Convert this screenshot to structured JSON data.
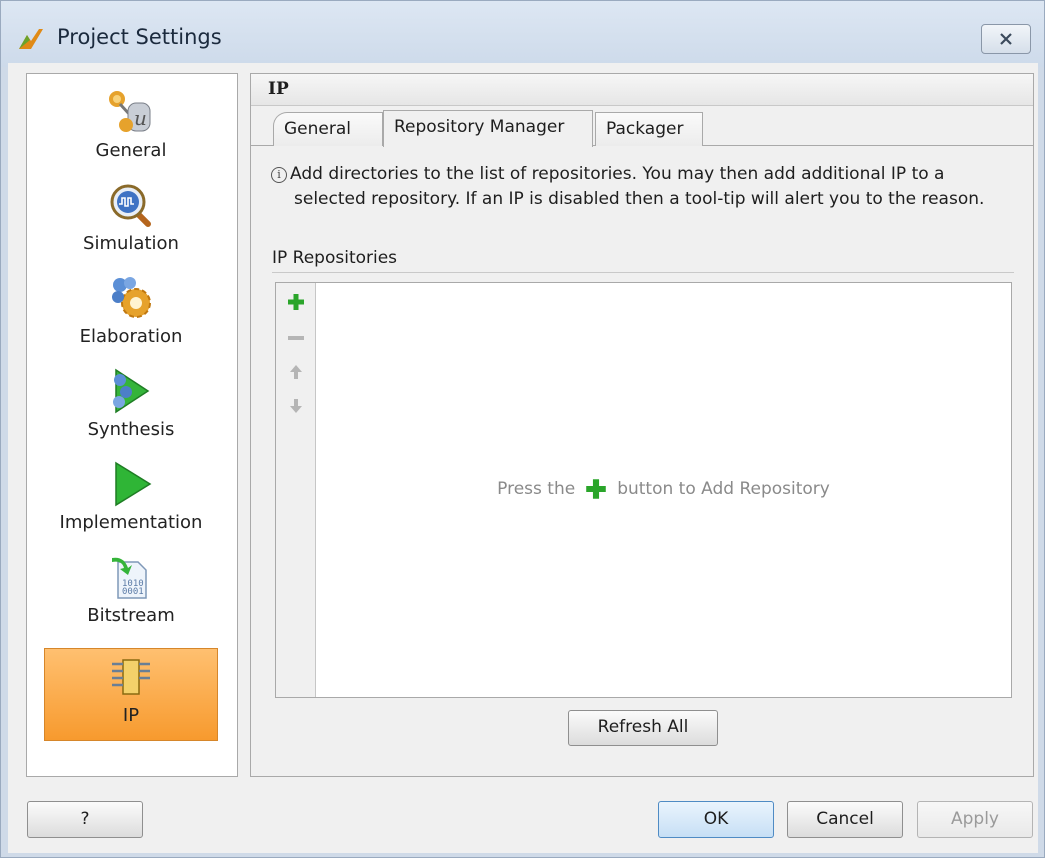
{
  "window": {
    "title": "Project Settings"
  },
  "sidebar": {
    "items": [
      {
        "label": "General",
        "icon": "general-icon",
        "selected": false
      },
      {
        "label": "Simulation",
        "icon": "simulation-icon",
        "selected": false
      },
      {
        "label": "Elaboration",
        "icon": "elaboration-icon",
        "selected": false
      },
      {
        "label": "Synthesis",
        "icon": "synthesis-icon",
        "selected": false
      },
      {
        "label": "Implementation",
        "icon": "implementation-icon",
        "selected": false
      },
      {
        "label": "Bitstream",
        "icon": "bitstream-icon",
        "selected": false
      },
      {
        "label": "IP",
        "icon": "ip-icon",
        "selected": true
      }
    ]
  },
  "panel": {
    "header": "IP",
    "tabs": [
      {
        "label": "General",
        "selected": false
      },
      {
        "label": "Repository Manager",
        "selected": true
      },
      {
        "label": "Packager",
        "selected": false
      }
    ],
    "info_first": "Add directories to the list of repositories. You may then add additional IP to a",
    "info_rest": "selected repository. If an IP is disabled then a tool-tip will alert you to the reason.",
    "section_title": "IP Repositories",
    "empty_before": "Press the",
    "empty_after": "button to Add Repository",
    "refresh_label": "Refresh All"
  },
  "footer": {
    "help_label": "?",
    "ok_label": "OK",
    "cancel_label": "Cancel",
    "apply_label": "Apply"
  },
  "colors": {
    "selected_item": "#f79a2e",
    "add_green": "#2aa52a",
    "ok_blue": "#c6dff5"
  }
}
